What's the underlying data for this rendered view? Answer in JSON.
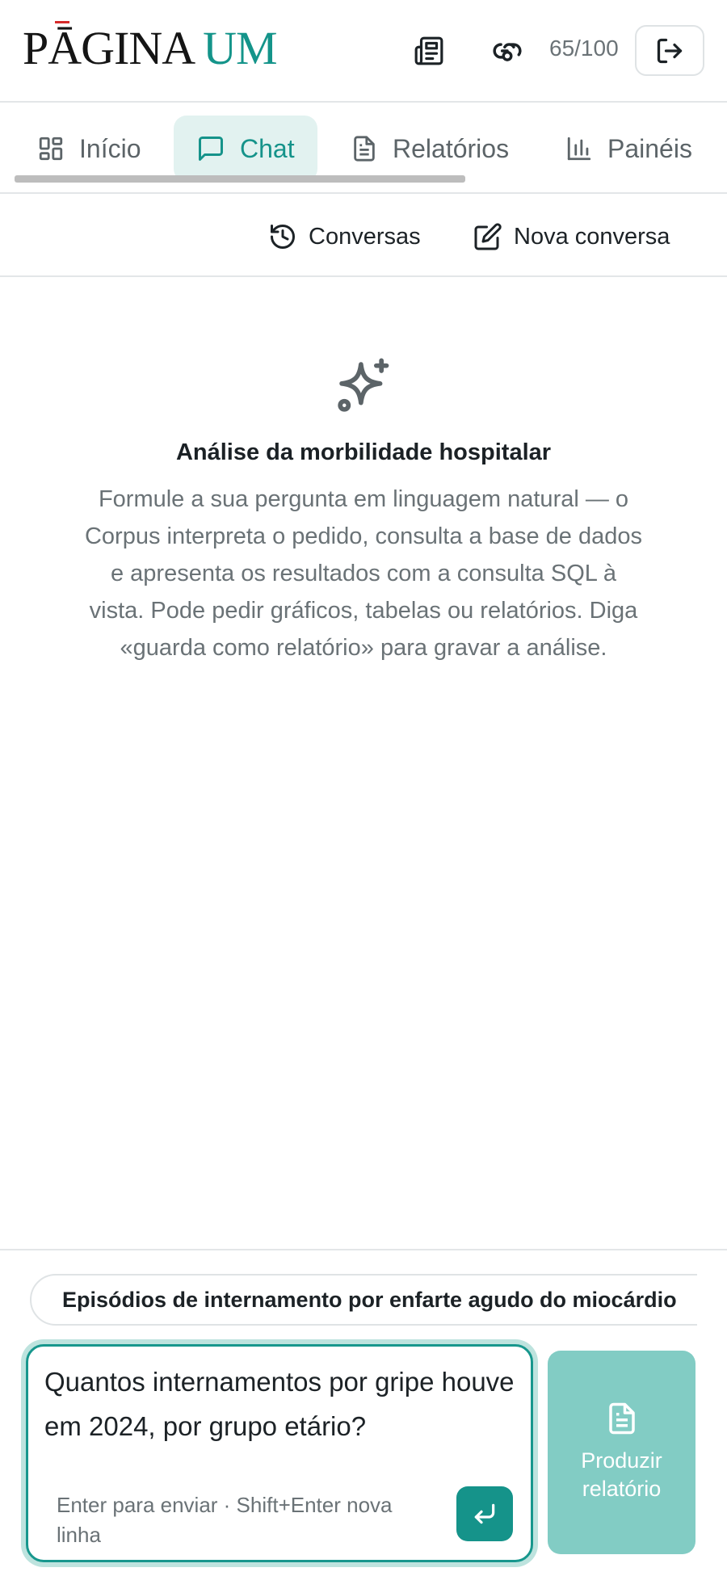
{
  "header": {
    "logo_part1": "PĀGINA",
    "logo_part2": "UM",
    "quota": "65/100",
    "icons": [
      "newspaper-icon",
      "link-icon",
      "logout-icon"
    ]
  },
  "tabs": [
    {
      "label": "Início",
      "icon": "grid-icon",
      "active": false
    },
    {
      "label": "Chat",
      "icon": "chat-icon",
      "active": true
    },
    {
      "label": "Relatórios",
      "icon": "document-icon",
      "active": false
    },
    {
      "label": "Painéis",
      "icon": "bar-chart-icon",
      "active": false
    }
  ],
  "subbar": {
    "conversations_label": "Conversas",
    "new_conversation_label": "Nova conversa"
  },
  "empty_state": {
    "icon": "sparkle-icon",
    "title": "Análise da morbilidade hospitalar",
    "description": "Formule a sua pergunta em linguagem natural — o Corpus interpreta o pedido, consulta a base de dados e apresenta os resultados com a consulta SQL à vista. Pode pedir gráficos, tabelas ou relatórios. Diga «guarda como relatório» para gravar a análise."
  },
  "suggestion": "Episódios de internamento por enfarte agudo do miocárdio",
  "composer": {
    "value": "Quantos internamentos por gripe houve em 2024, por grupo etário?",
    "hint": "Enter para enviar · Shift+Enter nova linha"
  },
  "report_button": {
    "line1": "Produzir",
    "line2": "relatório"
  },
  "colors": {
    "accent": "#15938a",
    "accent_soft": "#e2f2f0",
    "report_button": "#82ccc4",
    "logo_mark": "#d62a2a"
  }
}
